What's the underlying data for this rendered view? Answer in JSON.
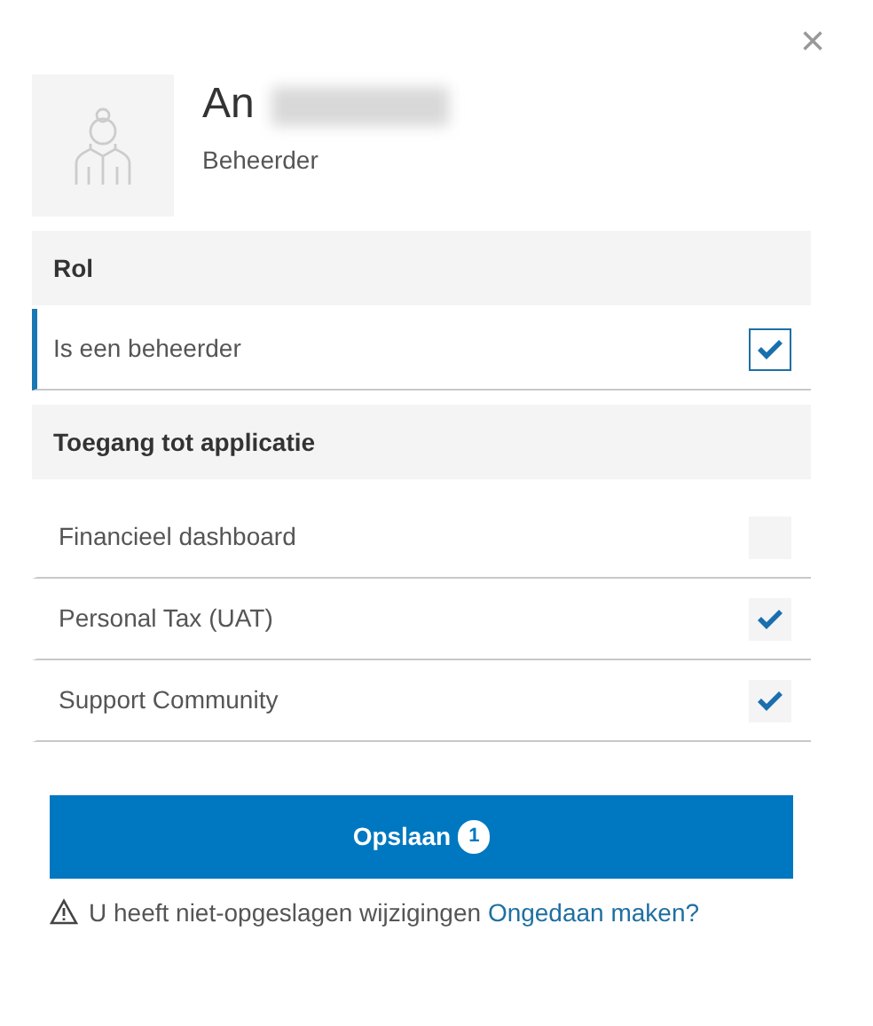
{
  "close": "×",
  "user": {
    "first_name": "An",
    "role": "Beheerder"
  },
  "sections": [
    {
      "title": "Rol",
      "items": [
        {
          "label": "Is een beheerder",
          "checked": true,
          "selected": true
        }
      ]
    },
    {
      "title": "Toegang tot applicatie",
      "items": [
        {
          "label": "Financieel dashboard",
          "checked": false,
          "selected": false
        },
        {
          "label": "Personal Tax (UAT)",
          "checked": true,
          "selected": false
        },
        {
          "label": "Support Community",
          "checked": true,
          "selected": false
        }
      ]
    }
  ],
  "save": {
    "label": "Opslaan",
    "count": "1"
  },
  "warning": {
    "text": "U heeft niet-opgeslagen wijzigingen",
    "link": "Ongedaan maken?"
  }
}
